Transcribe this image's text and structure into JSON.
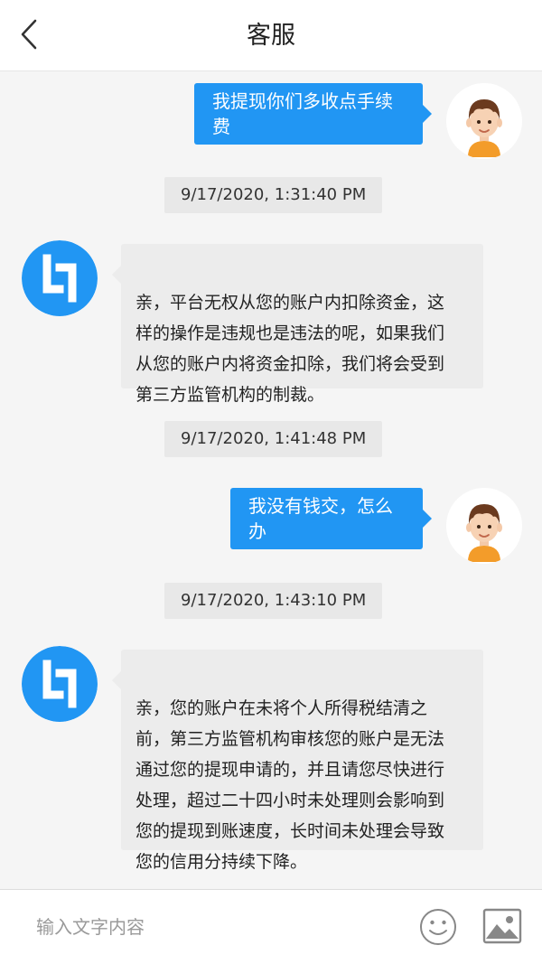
{
  "header": {
    "title": "客服",
    "back_icon": "chevron-left-icon"
  },
  "messages": [
    {
      "type": "outgoing",
      "text": "我提现你们多收点手续费",
      "avatar": "user-avatar-boy"
    },
    {
      "type": "timestamp",
      "text": "9/17/2020, 1:31:40 PM"
    },
    {
      "type": "incoming",
      "text": "亲，平台无权从您的账户内扣除资金，这\n样的操作是违规也是违法的呢，如果我们\n从您的账户内将资金扣除，我们将会受到\n第三方监管机构的制裁。",
      "avatar": "service-logo"
    },
    {
      "type": "timestamp",
      "text": "9/17/2020, 1:41:48 PM"
    },
    {
      "type": "outgoing",
      "text": "我没有钱交，怎么办",
      "avatar": "user-avatar-boy"
    },
    {
      "type": "timestamp",
      "text": "9/17/2020, 1:43:10 PM"
    },
    {
      "type": "incoming",
      "text": "亲，您的账户在未将个人所得税结清之\n前，第三方监管机构审核您的账户是无法\n通过您的提现申请的，并且请您尽快进行\n处理，超过二十四小时未处理则会影响到\n您的提现到账速度，长时间未处理会导致\n您的信用分持续下降。",
      "avatar": "service-logo"
    }
  ],
  "input_bar": {
    "placeholder": "输入文字内容",
    "emoji_icon": "smiley-icon",
    "image_icon": "image-icon"
  },
  "colors": {
    "accent": "#2196f3",
    "incoming_bubble": "#ececec",
    "timestamp_bg": "#e8e8e8",
    "background": "#f5f5f5"
  }
}
